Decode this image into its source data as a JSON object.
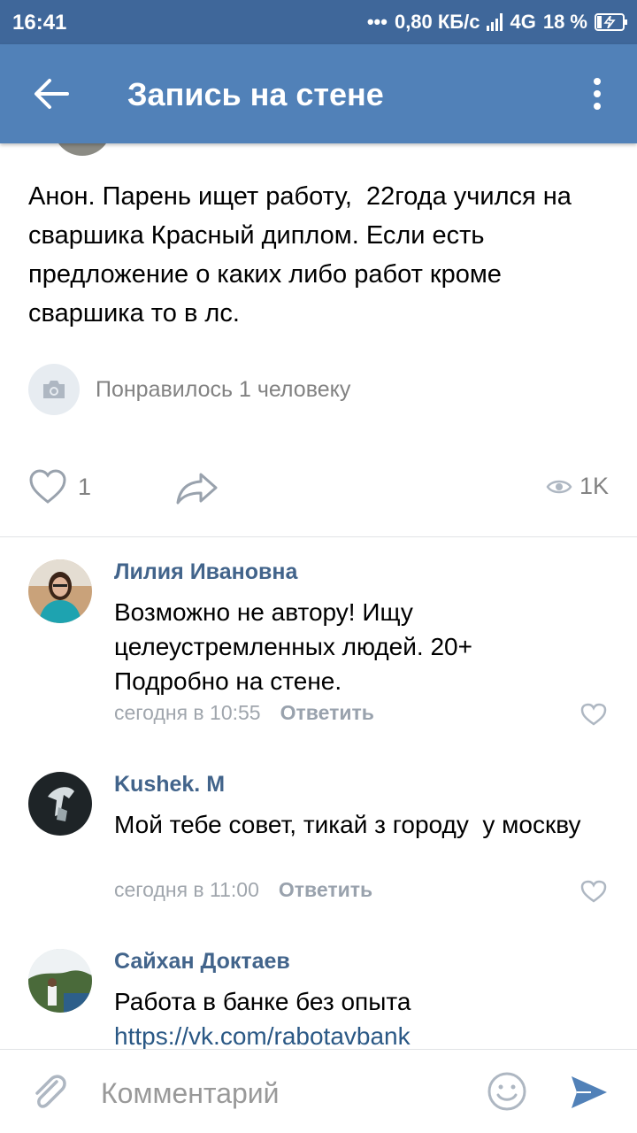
{
  "status": {
    "time": "16:41",
    "network_speed": "0,80 КБ/с",
    "network_type": "4G",
    "battery_percent": "18 %",
    "battery_level": 0.18
  },
  "header": {
    "title": "Запись на стене"
  },
  "post": {
    "text": "Анон. Парень ищет работу,  22года учился на сваршика Красный диплом. Если есть предложение о каких либо работ кроме сваршика то в лс.",
    "liked_by": "Понравилось 1 человеку",
    "likes_count": "1",
    "views_count": "1K"
  },
  "comments": [
    {
      "author": "Лилия Ивановна",
      "text": "Возможно не автору! Ищу целеустремленных людей. 20+ Подробно на стене.",
      "time": "сегодня в 10:55",
      "reply_label": "Ответить"
    },
    {
      "author": "Kushek. M",
      "text": "Мой тебе совет, тикай з городу  у москву",
      "time": "сегодня в 11:00",
      "reply_label": "Ответить"
    },
    {
      "author": "Сайхан Доктаев",
      "text": "Работа в банке без опыта",
      "link": "https://vk.com/rabotavbank"
    }
  ],
  "composer": {
    "placeholder": "Комментарий"
  },
  "colors": {
    "status_bar": "#3f679a",
    "app_bar": "#5181b8",
    "author_name": "#42648b",
    "link": "#2a5885",
    "secondary_text": "#828282"
  }
}
